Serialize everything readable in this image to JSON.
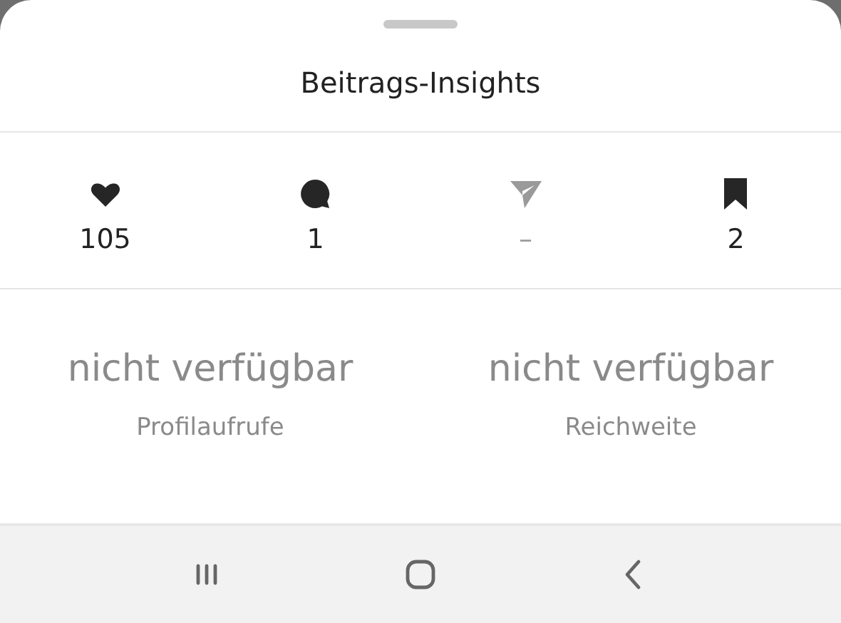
{
  "sheet": {
    "title": "Beitrags-Insights"
  },
  "stats": [
    {
      "kind": "like",
      "value": "105",
      "disabled": false
    },
    {
      "kind": "comment",
      "value": "1",
      "disabled": false
    },
    {
      "kind": "share",
      "value": "–",
      "disabled": true
    },
    {
      "kind": "save",
      "value": "2",
      "disabled": false
    }
  ],
  "metrics": [
    {
      "value": "nicht verfügbar",
      "label": "Profilaufrufe"
    },
    {
      "value": "nicht verfügbar",
      "label": "Reichweite"
    }
  ],
  "nav_bar": [
    {
      "kind": "recents"
    },
    {
      "kind": "home"
    },
    {
      "kind": "back"
    }
  ]
}
